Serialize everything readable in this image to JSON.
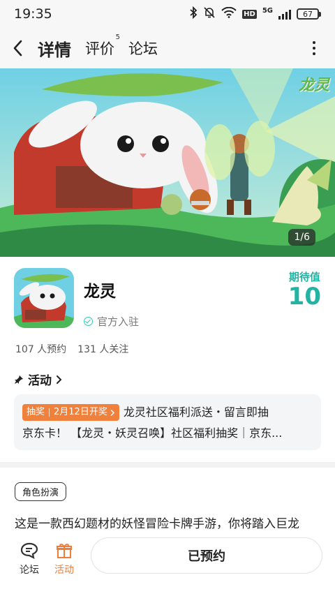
{
  "status_bar": {
    "time": "19:35",
    "hd": "HD",
    "network": "5G",
    "battery": "67"
  },
  "header": {
    "tabs": [
      {
        "label": "详情",
        "active": true
      },
      {
        "label": "评价",
        "badge": "5"
      },
      {
        "label": "论坛"
      }
    ]
  },
  "banner": {
    "counter": "1/6",
    "watermark": "龙灵"
  },
  "app": {
    "title": "龙灵",
    "official": "官方入驻",
    "expect_label": "期待值",
    "expect_value": "10",
    "reservations": "107 人预约",
    "followers": "131 人关注"
  },
  "activity": {
    "title": "活动",
    "tag_left": "抽奖",
    "tag_right": "2月12日开奖",
    "line1": "龙灵社区福利派送・留言即抽",
    "line2": "京东卡！ 【龙灵・妖灵召唤】社区福利抽奖｜京东..."
  },
  "details": {
    "genre": "角色扮演",
    "description": "这是一款西幻题材的妖怪冒险卡牌手游，你将踏入巨龙"
  },
  "bottom_bar": {
    "forum_label": "论坛",
    "activity_label": "活动",
    "reserve_label": "已预约"
  },
  "colors": {
    "accent_teal": "#23b3a2",
    "tab_underline": "#3fd6c4",
    "lottery_orange": "#f0813d"
  }
}
